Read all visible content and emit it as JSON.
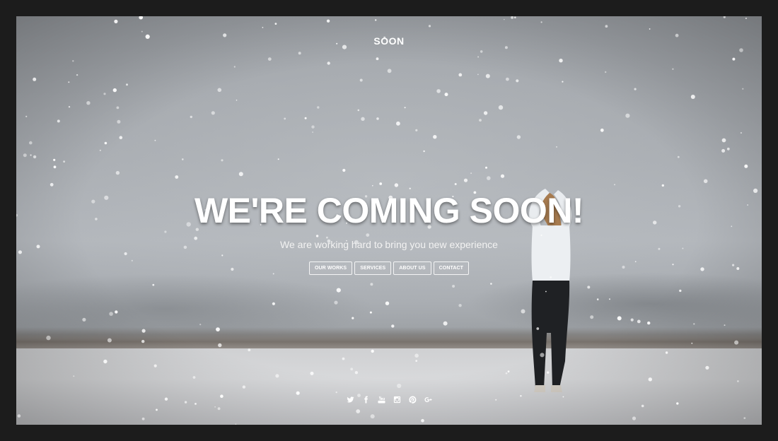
{
  "brand": "SOON",
  "hero": {
    "headline": "WE'RE COMING SOON!",
    "subline": "We are working hard to bring you new experience"
  },
  "nav": [
    {
      "label": "OUR WORKS"
    },
    {
      "label": "SERVICES"
    },
    {
      "label": "ABOUT US"
    },
    {
      "label": "CONTACT"
    }
  ],
  "social": [
    {
      "icon": "twitter-icon"
    },
    {
      "icon": "facebook-icon"
    },
    {
      "icon": "youtube-icon"
    },
    {
      "icon": "instagram-icon"
    },
    {
      "icon": "pinterest-icon"
    },
    {
      "icon": "google-plus-icon"
    }
  ],
  "colors": {
    "text": "#ffffff",
    "page_border": "#1c1c1c"
  }
}
